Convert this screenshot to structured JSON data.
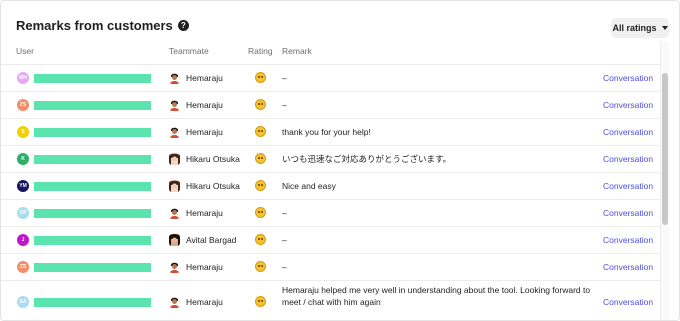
{
  "header": {
    "title": "Remarks from customers",
    "help_icon": "?",
    "filter_label": "All ratings"
  },
  "columns": {
    "user": "User",
    "teammate": "Teammate",
    "rating": "Rating",
    "remark": "Remark"
  },
  "colors": {
    "link": "#4d4de2",
    "redaction": "#5be4ad",
    "rating": "#f2c232"
  },
  "rows": [
    {
      "initials": "MH",
      "avatar_color": "#e8a7f2",
      "teammate": "Hemaraju",
      "teammate_avatar": "male",
      "rating_icon": "grinning-emoji-icon",
      "remark": "–",
      "action": "Conversation"
    },
    {
      "initials": "ZS",
      "avatar_color": "#f28c6b",
      "teammate": "Hemaraju",
      "teammate_avatar": "male",
      "rating_icon": "grinning-emoji-icon",
      "remark": "–",
      "action": "Conversation"
    },
    {
      "initials": "S",
      "avatar_color": "#f0d000",
      "teammate": "Hemaraju",
      "teammate_avatar": "male",
      "rating_icon": "grinning-emoji-icon",
      "remark": "thank you for your help!",
      "action": "Conversation"
    },
    {
      "initials": "K",
      "avatar_color": "#2fae68",
      "teammate": "Hikaru Otsuka",
      "teammate_avatar": "female",
      "rating_icon": "grinning-emoji-icon",
      "remark": "いつも迅速なご対応ありがとうございます。",
      "action": "Conversation"
    },
    {
      "initials": "YM",
      "avatar_color": "#151561",
      "teammate": "Hikaru Otsuka",
      "teammate_avatar": "female",
      "rating_icon": "grinning-emoji-icon",
      "remark": "Nice and easy",
      "action": "Conversation"
    },
    {
      "initials": "OP",
      "avatar_color": "#a9dcef",
      "teammate": "Hemaraju",
      "teammate_avatar": "male",
      "rating_icon": "smiling-emoji-icon",
      "remark": "–",
      "action": "Conversation"
    },
    {
      "initials": "J",
      "avatar_color": "#c116cc",
      "teammate": "Avital Bargad",
      "teammate_avatar": "female-dark",
      "rating_icon": "grinning-emoji-icon",
      "remark": "–",
      "action": "Conversation"
    },
    {
      "initials": "ZS",
      "avatar_color": "#f28c6b",
      "teammate": "Hemaraju",
      "teammate_avatar": "male",
      "rating_icon": "smiling-emoji-icon",
      "remark": "–",
      "action": "Conversation"
    },
    {
      "initials": "SA",
      "avatar_color": "#a9dcef",
      "teammate": "Hemaraju",
      "teammate_avatar": "male",
      "rating_icon": "grinning-emoji-icon",
      "remark": "Hemaraju helped me very well in understanding about the tool. Looking forward to meet / chat with him again",
      "action": "Conversation"
    }
  ]
}
